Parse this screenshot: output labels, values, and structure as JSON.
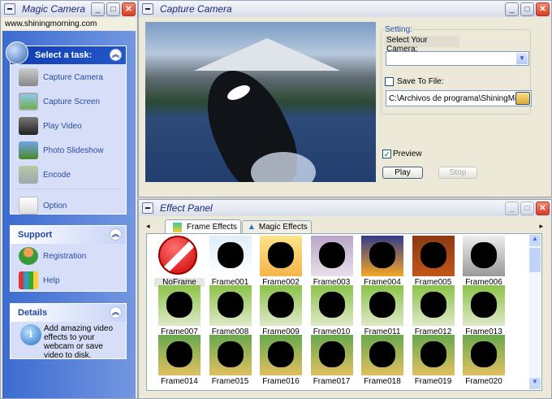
{
  "left_window": {
    "title": "Magic Camera",
    "url": "www.shiningmorning.com",
    "tasks": {
      "header": "Select a task:",
      "items": [
        "Capture Camera",
        "Capture Screen",
        "Play Video",
        "Photo Slideshow",
        "Encode",
        "Option"
      ]
    },
    "support": {
      "header": "Support",
      "items": [
        "Registration",
        "Help"
      ]
    },
    "details": {
      "header": "Details",
      "text": "Add amazing video effects to your webcam or save video to disk."
    }
  },
  "capture_window": {
    "title": "Capture Camera",
    "setting_label": "Setting:",
    "select_camera_label": "Select Your Camera:",
    "camera_value": "",
    "save_to_file_label": "Save To File:",
    "save_to_file_checked": false,
    "file_path": "C:\\Archivos de programa\\ShiningMorn",
    "preview_label": "Preview",
    "preview_checked": true,
    "play_label": "Play",
    "stop_label": "Stop"
  },
  "effect_window": {
    "title": "Effect Panel",
    "tabs": [
      "Frame Effects",
      "Magic Effects"
    ],
    "active_tab": "Frame Effects",
    "frames": [
      "NoFrame",
      "Frame001",
      "Frame002",
      "Frame003",
      "Frame004",
      "Frame005",
      "Frame006",
      "Frame007",
      "Frame008",
      "Frame009",
      "Frame010",
      "Frame011",
      "Frame012",
      "Frame013",
      "Frame014",
      "Frame015",
      "Frame016",
      "Frame017",
      "Frame018",
      "Frame019",
      "Frame020"
    ]
  },
  "colors": {
    "accent": "#2457c9",
    "panel": "#d6dff7"
  }
}
